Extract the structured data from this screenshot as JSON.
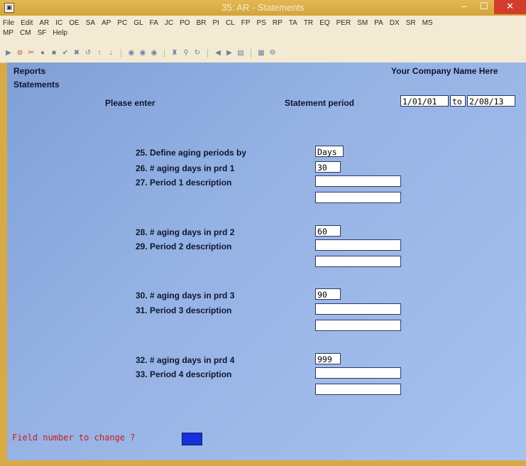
{
  "window": {
    "title": "35: AR - Statements"
  },
  "menu": {
    "row1": [
      "File",
      "Edit",
      "AR",
      "IC",
      "OE",
      "SA",
      "AP",
      "PC",
      "GL",
      "FA",
      "JC",
      "PO",
      "BR",
      "PI",
      "CL",
      "FP",
      "PS",
      "RP",
      "TA",
      "TR",
      "EQ",
      "PER",
      "SM",
      "PA",
      "DX",
      "SR",
      "MS"
    ],
    "row2": [
      "MP",
      "CM",
      "SF",
      "Help"
    ]
  },
  "header": {
    "reports": "Reports",
    "company": "Your Company Name Here",
    "statements": "Statements",
    "please_enter": "Please enter",
    "statement_period_label": "Statement period",
    "period_from": "1/01/01",
    "to_label": "to",
    "period_to": "2/08/13"
  },
  "fields": {
    "f25_label": "25. Define aging periods by",
    "f25_value": "Days",
    "f26_label": "26. # aging days in prd 1",
    "f26_value": "30",
    "f27_label": "27. Period 1 description",
    "f27_value_a": "",
    "f27_value_b": "",
    "f28_label": "28. # aging days in prd 2",
    "f28_value": "60",
    "f29_label": "29. Period 2 description",
    "f29_value_a": "",
    "f29_value_b": "",
    "f30_label": "30. # aging days in prd 3",
    "f30_value": "90",
    "f31_label": "31. Period 3 description",
    "f31_value_a": "",
    "f31_value_b": "",
    "f32_label": "32. # aging days in prd 4",
    "f32_value": "999",
    "f33_label": "33. Period 4 description",
    "f33_value_a": "",
    "f33_value_b": ""
  },
  "prompt": {
    "text": "Field number to change ?"
  },
  "colors": {
    "titlebar": "#d8aa45",
    "client_bg": "#95b2e4",
    "prompt": "#cc1a22",
    "cursor": "#1531d8"
  }
}
